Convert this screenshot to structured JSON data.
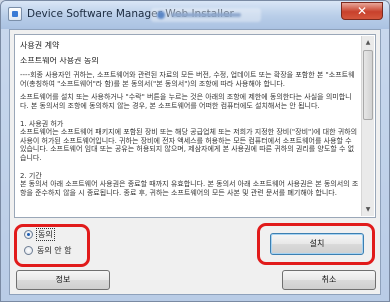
{
  "window": {
    "title": "Device Software Manager Web Installer",
    "close_glyph": "✕"
  },
  "license": {
    "heading": "사용권 계약",
    "title": "소프트웨어 사용권 동의",
    "paragraphs": [
      "----회종 사용자인 귀하는, 소프트웨어와 관련된 자료의 모든 버전, 수정, 업데이트 또는 확장을 포함한 본 \"소프트웨어(총칭하여 \"소프트웨어\"라 함)를 본 동의서(\"본 동의서\")의 조항에 따라 사용해야 합니다.",
      "소프트웨어를 설치 또는 사용하거나 \"수락\" 버튼을 누르는 것은 아래의 조항에 제한에 동의한다는 사실을 의미합니다. 본 동의서의 조항에 동의하지 않는 경우, 본 소프트웨어를 어떠한 컴퓨터에도 설치해서는 안 됩니다.",
      "1. 사용권 허가\n소프트웨어는 소프트웨어 패키지에 포함된 장비 또는 해당 공급업체 또는 저희가 지정한 장비(\"장비\")에 대한 귀하의 사용이 허가된 소프트웨어입니다. 귀하는 장비에 전자 액세스를 허용하는 모든 컴퓨터에서 소프트웨어를 사용할 수 있습니다. 소프트웨어 임대 또는 공유는 허용되지 않으며, 제삼자에게 본 사용권에 따른 귀하의 권리를 양도할 수 없습니다.",
      "2. 기간\n본 동의서 아래 소프트웨어 사용권은 종료할 때까지 유효합니다. 본 동의서 아래 소프트웨어 사용권은 본 동의서의 조항을 준수하지 않을 시 종료됩니다. 종료 후, 귀하는 소프트웨어의 모든 사본 및 관련 문서를 폐기해야 합니다."
    ]
  },
  "options": {
    "agree": "동의",
    "disagree": "동의 안 함",
    "selected": "agree"
  },
  "buttons": {
    "install": "설치",
    "info": "정보",
    "cancel": "취소"
  },
  "colors": {
    "highlight_outline": "#e11b1b",
    "window_frame": "#b9cce6",
    "close_button": "#c8412c"
  },
  "icons": {
    "app": "installer-app-icon",
    "close": "close-icon",
    "scroll_up": "scroll-up-arrow-icon",
    "scroll_down": "scroll-down-arrow-icon"
  }
}
